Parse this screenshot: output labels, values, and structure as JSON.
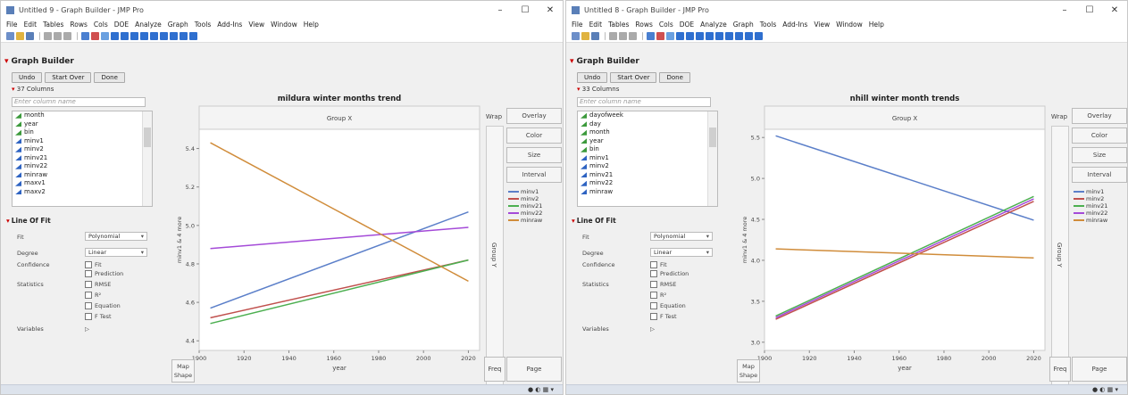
{
  "windows": [
    {
      "title": "Untitled 9 - Graph Builder - JMP Pro",
      "menus": [
        "File",
        "Edit",
        "Tables",
        "Rows",
        "Cols",
        "DOE",
        "Analyze",
        "Graph",
        "Tools",
        "Add-Ins",
        "View",
        "Window",
        "Help"
      ],
      "gb_title": "Graph Builder",
      "buttons": {
        "undo": "Undo",
        "startover": "Start Over",
        "done": "Done"
      },
      "columns_count": "37 Columns",
      "filter_placeholder": "Enter column name",
      "columns": [
        {
          "name": "month",
          "kind": "g"
        },
        {
          "name": "year",
          "kind": "g"
        },
        {
          "name": "bin",
          "kind": "g"
        },
        {
          "name": "minv1",
          "kind": "b"
        },
        {
          "name": "minv2",
          "kind": "b"
        },
        {
          "name": "minv21",
          "kind": "b"
        },
        {
          "name": "minv22",
          "kind": "b"
        },
        {
          "name": "minraw",
          "kind": "b"
        },
        {
          "name": "maxv1",
          "kind": "b"
        },
        {
          "name": "maxv2",
          "kind": "b"
        }
      ],
      "lof": {
        "title": "Line Of Fit",
        "fit_label": "Fit",
        "fit_value": "Polynomial",
        "degree_label": "Degree",
        "degree_value": "Linear",
        "confidence_label": "Confidence",
        "conf_fit": "Fit",
        "conf_prediction": "Prediction",
        "statistics_label": "Statistics",
        "rmse": "RMSE",
        "r2": "R²",
        "equation": "Equation",
        "ftest": "F Test",
        "variables_label": "Variables"
      },
      "chart_data": {
        "type": "line",
        "title": "mildura winter months trend",
        "group_x": "Group X",
        "group_y": "Group Y",
        "xlabel": "year",
        "ylabel": "minv1 & 4 more",
        "xlim": [
          1900,
          2025
        ],
        "ylim": [
          4.35,
          5.5
        ],
        "xticks": [
          1900,
          1920,
          1940,
          1960,
          1980,
          2000,
          2020
        ],
        "yticks": [
          4.4,
          4.6,
          4.8,
          5.0,
          5.2,
          5.4
        ],
        "ytick_labels": [
          "4.4",
          "4.6",
          "4.8",
          "5.0",
          "5.2",
          "5.4"
        ],
        "series": [
          {
            "name": "minv1",
            "color": "#5b7fc9",
            "x": [
              1905,
              2020
            ],
            "y": [
              4.57,
              5.07
            ]
          },
          {
            "name": "minv2",
            "color": "#c0504d",
            "x": [
              1905,
              2020
            ],
            "y": [
              4.52,
              4.82
            ]
          },
          {
            "name": "minv21",
            "color": "#4caf50",
            "x": [
              1905,
              2020
            ],
            "y": [
              4.49,
              4.82
            ]
          },
          {
            "name": "minv22",
            "color": "#a44ad8",
            "x": [
              1905,
              2020
            ],
            "y": [
              4.88,
              4.99
            ]
          },
          {
            "name": "minraw",
            "color": "#d08c3a",
            "x": [
              1905,
              2020
            ],
            "y": [
              5.43,
              4.71
            ]
          }
        ]
      },
      "side": {
        "wrap": "Wrap",
        "overlay": "Overlay",
        "color": "Color",
        "size": "Size",
        "interval": "Interval",
        "freq": "Freq",
        "page": "Page",
        "map_shape": "Map Shape"
      }
    },
    {
      "title": "Untitled 8 - Graph Builder - JMP Pro",
      "menus": [
        "File",
        "Edit",
        "Tables",
        "Rows",
        "Cols",
        "DOE",
        "Analyze",
        "Graph",
        "Tools",
        "Add-Ins",
        "View",
        "Window",
        "Help"
      ],
      "gb_title": "Graph Builder",
      "buttons": {
        "undo": "Undo",
        "startover": "Start Over",
        "done": "Done"
      },
      "columns_count": "33 Columns",
      "filter_placeholder": "Enter column name",
      "columns": [
        {
          "name": "dayofweek",
          "kind": "g"
        },
        {
          "name": "day",
          "kind": "g"
        },
        {
          "name": "month",
          "kind": "g"
        },
        {
          "name": "year",
          "kind": "g"
        },
        {
          "name": "bin",
          "kind": "g"
        },
        {
          "name": "minv1",
          "kind": "b"
        },
        {
          "name": "minv2",
          "kind": "b"
        },
        {
          "name": "minv21",
          "kind": "b"
        },
        {
          "name": "minv22",
          "kind": "b"
        },
        {
          "name": "minraw",
          "kind": "b"
        }
      ],
      "lof": {
        "title": "Line Of Fit",
        "fit_label": "Fit",
        "fit_value": "Polynomial",
        "degree_label": "Degree",
        "degree_value": "Linear",
        "confidence_label": "Confidence",
        "conf_fit": "Fit",
        "conf_prediction": "Prediction",
        "statistics_label": "Statistics",
        "rmse": "RMSE",
        "r2": "R²",
        "equation": "Equation",
        "ftest": "F Test",
        "variables_label": "Variables"
      },
      "chart_data": {
        "type": "line",
        "title": "nhill winter month trends",
        "group_x": "Group X",
        "group_y": "Group Y",
        "xlabel": "year",
        "ylabel": "minv1 & 4 more",
        "xlim": [
          1900,
          2025
        ],
        "ylim": [
          2.9,
          5.6
        ],
        "xticks": [
          1900,
          1920,
          1940,
          1960,
          1980,
          2000,
          2020
        ],
        "yticks": [
          3.0,
          3.5,
          4.0,
          4.5,
          5.0,
          5.5
        ],
        "ytick_labels": [
          "3.0",
          "3.5",
          "4.0",
          "4.5",
          "5.0",
          "5.5"
        ],
        "series": [
          {
            "name": "minv1",
            "color": "#5b7fc9",
            "x": [
              1905,
              2020
            ],
            "y": [
              5.52,
              4.49
            ]
          },
          {
            "name": "minv2",
            "color": "#c0504d",
            "x": [
              1905,
              2020
            ],
            "y": [
              3.28,
              4.72
            ]
          },
          {
            "name": "minv21",
            "color": "#4caf50",
            "x": [
              1905,
              2020
            ],
            "y": [
              3.32,
              4.78
            ]
          },
          {
            "name": "minv22",
            "color": "#a44ad8",
            "x": [
              1905,
              2020
            ],
            "y": [
              3.3,
              4.75
            ]
          },
          {
            "name": "minraw",
            "color": "#d08c3a",
            "x": [
              1905,
              2020
            ],
            "y": [
              4.14,
              4.03
            ]
          }
        ]
      },
      "side": {
        "wrap": "Wrap",
        "overlay": "Overlay",
        "color": "Color",
        "size": "Size",
        "interval": "Interval",
        "freq": "Freq",
        "page": "Page",
        "map_shape": "Map Shape"
      }
    }
  ]
}
